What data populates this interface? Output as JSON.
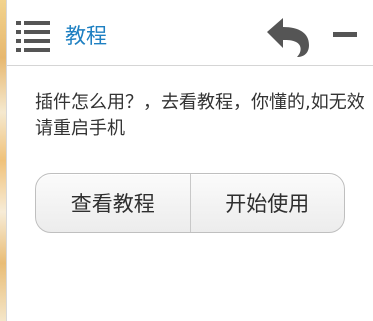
{
  "header": {
    "title": "教程",
    "menu_icon": "hamburger-list-icon",
    "back_icon": "back-arrow-icon",
    "minimize_icon": "minimize-icon"
  },
  "message": {
    "text": "插件怎么用？，去看教程，你懂的,如无效请重启手机"
  },
  "buttons": {
    "view_tutorial": "查看教程",
    "start_using": "开始使用"
  },
  "colors": {
    "title_blue": "#1e80c2",
    "icon_gray": "#555555"
  }
}
